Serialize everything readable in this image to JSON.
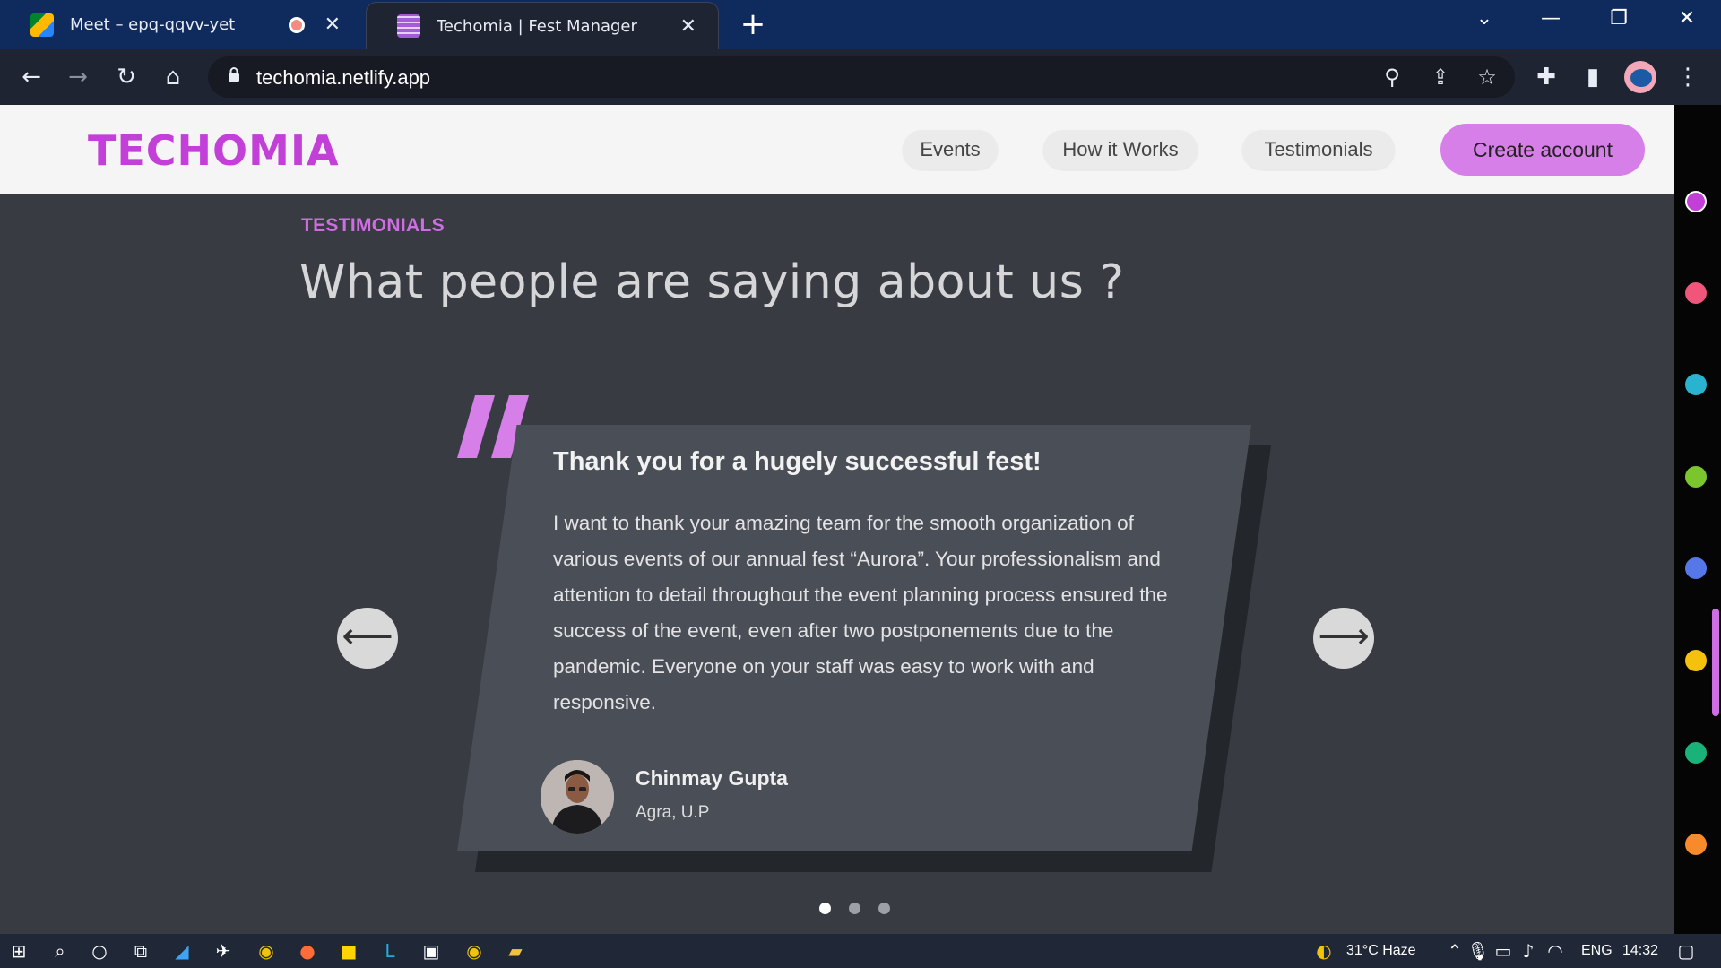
{
  "browser": {
    "tabs": [
      {
        "title": "Meet – epq-qqvv-yet",
        "active": false,
        "recording": true
      },
      {
        "title": "Techomia | Fest Manager",
        "active": true
      }
    ],
    "new_tab_label": "+",
    "url": "techomia.netlify.app"
  },
  "navbar": {
    "logo": "TECHOMIA",
    "links": [
      "Events",
      "How it Works",
      "Testimonials"
    ],
    "cta": "Create account"
  },
  "section": {
    "eyebrow": "TESTIMONIALS",
    "heading": "What people are saying about us ?"
  },
  "testimonial": {
    "title": "Thank you for a hugely successful fest!",
    "body": "I want to thank your amazing team for the smooth organization of various events of our annual fest “Aurora”. Your professionalism and attention to detail throughout the event planning process ensured the success of the event, even after two postponements due to the pandemic. Everyone on your staff was easy to work with and responsive.",
    "name": "Chinmay Gupta",
    "location": "Agra, U.P",
    "prev_arrow": "⟵",
    "next_arrow": "⟶"
  },
  "carousel": {
    "total": 3,
    "active_index": 0
  },
  "colors": {
    "brand": "#c23fd8",
    "accent_button": "#d77fe8",
    "page_bg": "#383b42",
    "card_bg": "#4a4e56",
    "swatches": [
      "#c23fd8",
      "#f0557a",
      "#29b3d1",
      "#7cc62d",
      "#5577e8",
      "#f4c20d",
      "#19b37a",
      "#f78a2b"
    ]
  },
  "taskbar": {
    "weather": "31°C  Haze",
    "language": "ENG",
    "time": "14:32"
  }
}
